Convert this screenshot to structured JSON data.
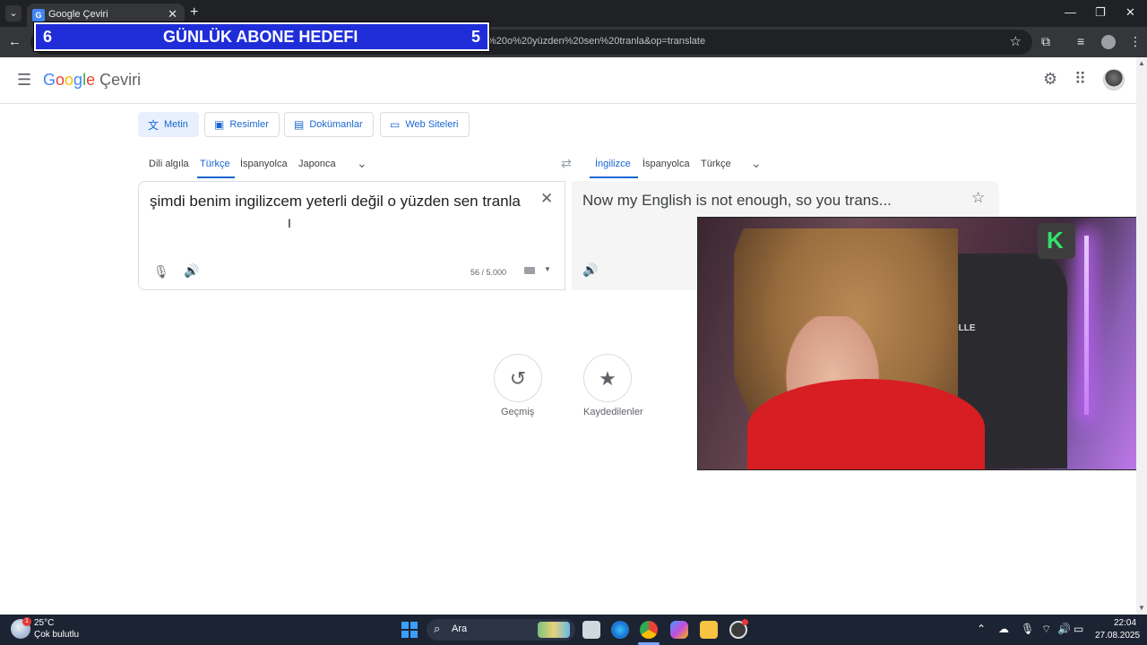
{
  "browser": {
    "tab_title": "Google Çeviri",
    "tab_favicon": "google-translate-icon",
    "url": "%20o%20yüzden%20sen%20tranla&op=translate",
    "icons": [
      "tab-list-icon",
      "close-icon",
      "plus-icon",
      "minimize-icon",
      "maximize-icon",
      "back-arrow-icon",
      "star-outline-icon",
      "extensions-icon",
      "media-icon",
      "more-vert-icon"
    ]
  },
  "overlay": {
    "left_number": "6",
    "title": "GÜNLÜK ABONE HEDEFI",
    "right_number": "5",
    "bg_color": "#1f2dd8"
  },
  "header": {
    "logo_product": "Çeviri"
  },
  "modes": [
    {
      "label": "Metin",
      "icon": "translate-icon",
      "active": true
    },
    {
      "label": "Resimler",
      "icon": "image-icon"
    },
    {
      "label": "Dokümanlar",
      "icon": "document-icon"
    },
    {
      "label": "Web Siteleri",
      "icon": "website-icon"
    }
  ],
  "source_languages": [
    "Dili algıla",
    "Türkçe",
    "İspanyolca",
    "Japonca"
  ],
  "target_languages": [
    "İngilizce",
    "İspanyolca",
    "Türkçe"
  ],
  "source": {
    "text": "şimdi benim ingilizcem yeterli değil o yüzden sen tranla",
    "char_count": "56 / 5.000"
  },
  "target": {
    "text": "Now my English is not enough, so you trans..."
  },
  "shortcuts": {
    "history_label": "Geçmiş",
    "saved_label": "Kaydedilenler"
  },
  "webcam": {
    "chair_brand": "FASHCOLLE",
    "logo_letter": "K"
  },
  "taskbar": {
    "temperature": "25°C",
    "weather_desc": "Çok bulutlu",
    "weather_badge": "1",
    "search_label": "Ara",
    "time": "22:04",
    "date": "27.08.2025"
  },
  "colors": {
    "accent": "#1967d2",
    "active_mode_bg": "#e8f0fe"
  }
}
